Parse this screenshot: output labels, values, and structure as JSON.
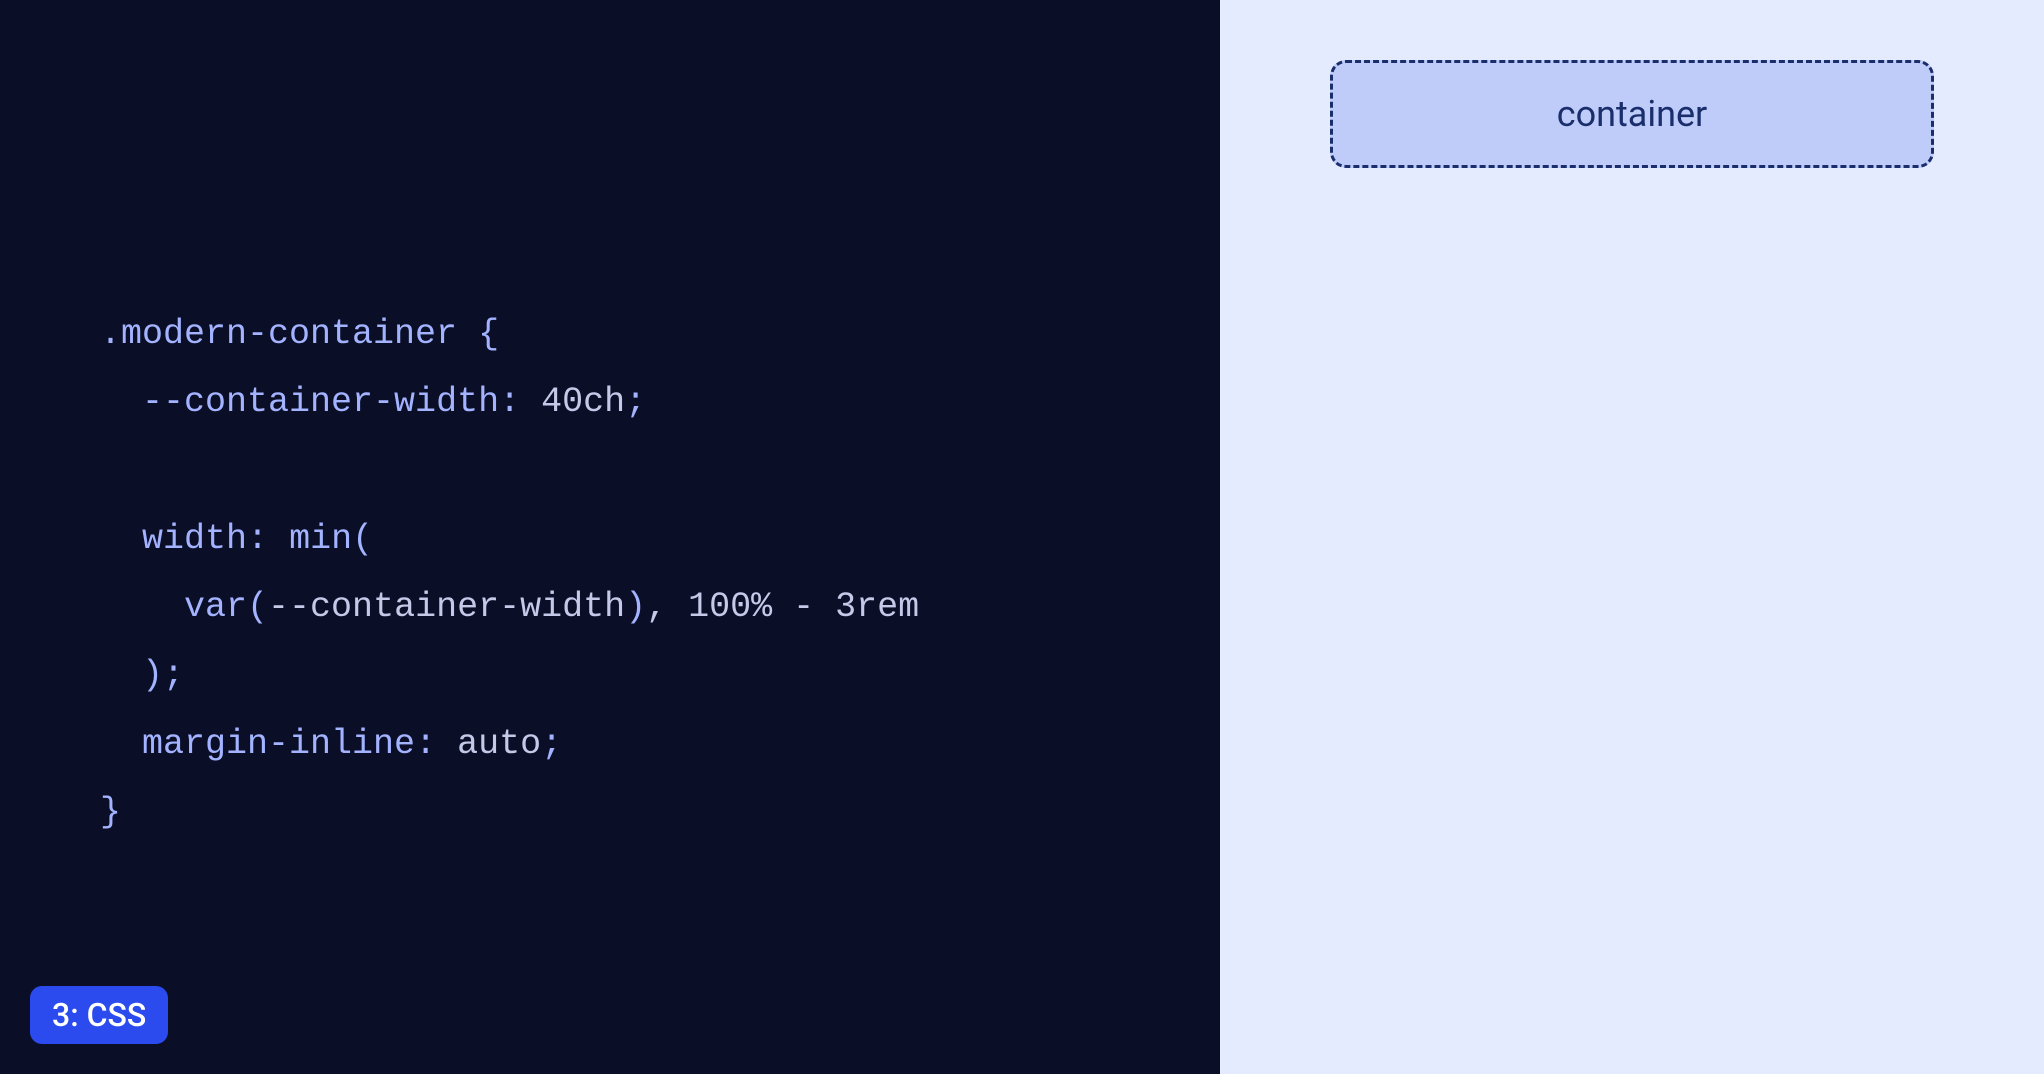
{
  "code": {
    "line1_selector": ".modern-container",
    "line1_brace": " {",
    "line2_indent": "  ",
    "line2_property": "--container-width",
    "line2_colon": ": ",
    "line2_value": "40ch",
    "line2_semi": ";",
    "line3": "",
    "line4_indent": "  ",
    "line4_property": "width",
    "line4_colon": ": ",
    "line4_func": "min",
    "line4_paren": "(",
    "line5_indent": "    ",
    "line5_func": "var",
    "line5_paren_open": "(",
    "line5_var": "--container-width",
    "line5_paren_close": ")",
    "line5_comma": ", ",
    "line5_value": "100% - 3rem",
    "line6_indent": "  ",
    "line6_paren": ")",
    "line6_semi": ";",
    "line7_indent": "  ",
    "line7_property": "margin-inline",
    "line7_colon": ": ",
    "line7_value": "auto",
    "line7_semi": ";",
    "line8_brace": "}"
  },
  "badge": {
    "label": "3: CSS"
  },
  "preview": {
    "container_label": "container"
  }
}
